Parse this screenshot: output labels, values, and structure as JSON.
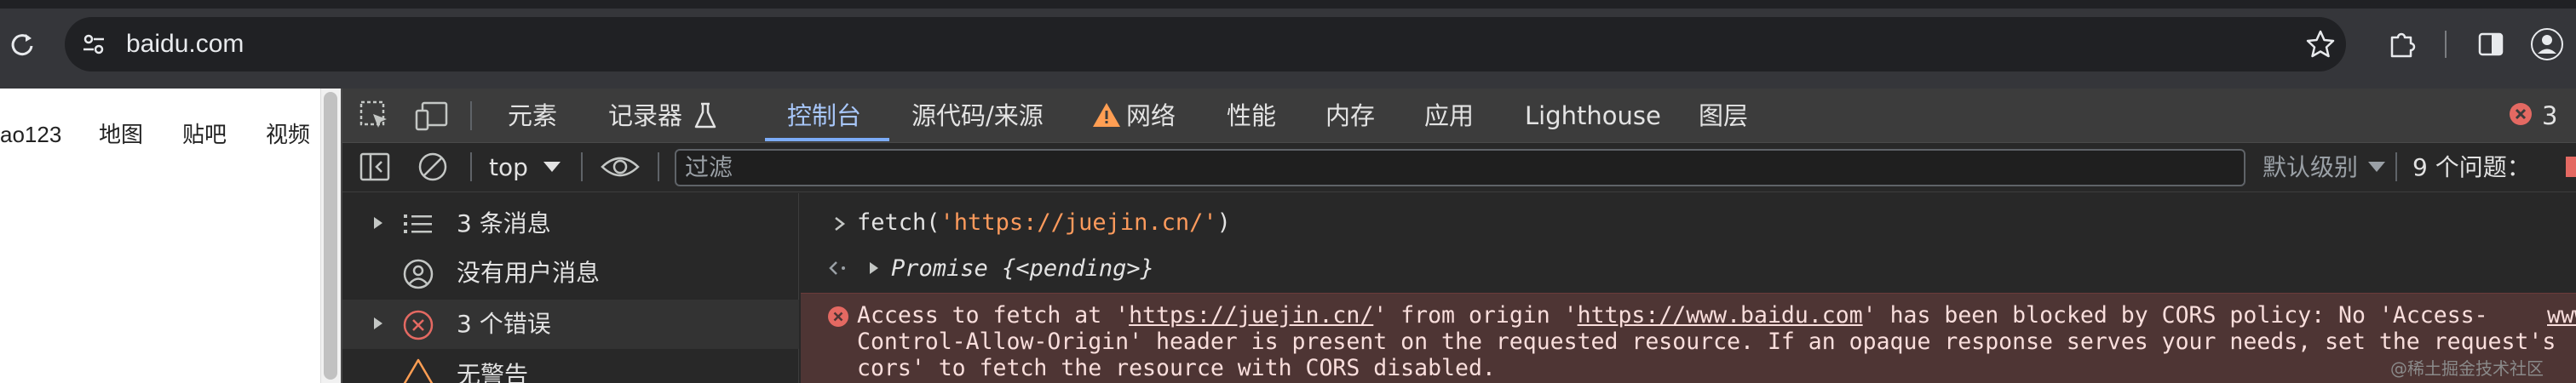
{
  "browser": {
    "url": "baidu.com",
    "icons": [
      "reload-icon",
      "site-settings-icon",
      "star-icon",
      "extensions-icon",
      "side-panel-icon",
      "profile-icon"
    ]
  },
  "page": {
    "nav_links": [
      "ao123",
      "地图",
      "贴吧",
      "视频"
    ]
  },
  "devtools": {
    "tabs": [
      {
        "label": "元素",
        "active": false
      },
      {
        "label": "记录器",
        "active": false
      },
      {
        "label": "控制台",
        "active": true
      },
      {
        "label": "源代码/来源",
        "active": false
      },
      {
        "label": "网络",
        "active": false
      },
      {
        "label": "性能",
        "active": false
      },
      {
        "label": "内存",
        "active": false
      },
      {
        "label": "应用",
        "active": false
      },
      {
        "label": "Lighthouse",
        "active": false
      },
      {
        "label": "图层",
        "active": false
      }
    ],
    "error_count": "3",
    "toolbar": {
      "context": "top",
      "filter_placeholder": "过滤",
      "log_level": "默认级别",
      "issues": "9 个问题："
    },
    "sidebar": [
      {
        "label": "3 条消息",
        "icon": "list-icon"
      },
      {
        "label": "没有用户消息",
        "icon": "user-icon"
      },
      {
        "label": "3 个错误",
        "icon": "error-icon"
      },
      {
        "label": "无警告",
        "icon": "warning-icon"
      }
    ],
    "console": {
      "input": {
        "fn": "fetch(",
        "arg": "'https://juejin.cn/'",
        "close": ")"
      },
      "result": {
        "label": "Promise",
        "state": "{<pending>}"
      },
      "error": {
        "p1": "Access to fetch at '",
        "url1": "https://juejin.cn/",
        "p2": "' from origin '",
        "url2": "https://www.baidu.com",
        "p3": "' has been blocked by CORS policy: No 'Access-",
        "source": "www",
        "line2": "Control-Allow-Origin' header is present on the requested resource. If an opaque response serves your needs, set the request's",
        "line3": "cors' to fetch the resource with CORS disabled."
      }
    },
    "watermark": "@稀土掘金技术社区"
  }
}
